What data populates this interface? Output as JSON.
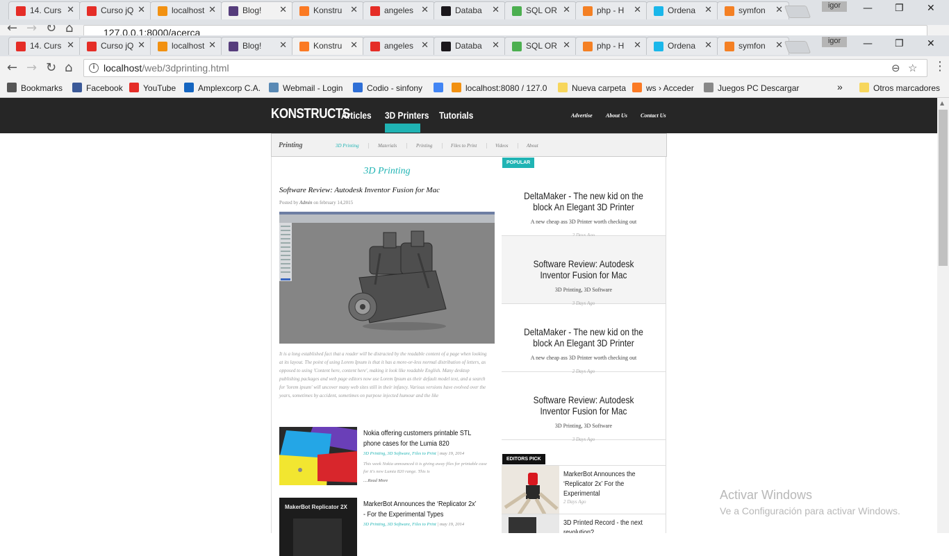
{
  "browser": {
    "tabs": [
      {
        "label": "14. Curs",
        "icon": "youtube-icon",
        "color": "#e52d27"
      },
      {
        "label": "Curso jQ",
        "icon": "youtube-icon",
        "color": "#e52d27"
      },
      {
        "label": "localhost",
        "icon": "phpmyadmin-icon",
        "color": "#f29111"
      },
      {
        "label": "Blog!",
        "icon": "bootstrap-icon",
        "color": "#563d7c"
      },
      {
        "label": "Konstru",
        "icon": "xampp-icon",
        "color": "#fb7a24"
      },
      {
        "label": "angeles",
        "icon": "youtube-icon",
        "color": "#e52d27"
      },
      {
        "label": "Databa",
        "icon": "symfony-icon",
        "color": "#1a171b"
      },
      {
        "label": "SQL OR",
        "icon": "w3schools-icon",
        "color": "#4caf50"
      },
      {
        "label": "php - H",
        "icon": "stackoverflow-icon",
        "color": "#f48024"
      },
      {
        "label": "Ordena",
        "icon": "vimeo-icon",
        "color": "#1ab7ea"
      },
      {
        "label": "symfon",
        "icon": "stackoverflow-icon",
        "color": "#f48024"
      }
    ],
    "back_active_tab": 3,
    "front_active_tab": 4,
    "profile": "igor",
    "back_url": "127.0.0.1:8000/acerca",
    "url_host": "localhost",
    "url_path": "/web/3dprinting.html",
    "bookmarks": [
      {
        "label": "Bookmarks",
        "icon": "star-icon",
        "color": "#555555"
      },
      {
        "label": "Facebook",
        "icon": "facebook-icon",
        "color": "#3b5998"
      },
      {
        "label": "YouTube",
        "icon": "youtube-icon",
        "color": "#e52d27"
      },
      {
        "label": "Amplexcorp C.A.",
        "icon": "amplexcorp-icon",
        "color": "#1565c0"
      },
      {
        "label": "Webmail - Login",
        "icon": "mail-icon",
        "color": "#5a8ab5"
      },
      {
        "label": "Codio - sinfony",
        "icon": "codio-icon",
        "color": "#2f6fd6"
      },
      {
        "label": "",
        "icon": "google-icon",
        "color": "#4285f4"
      },
      {
        "label": "localhost:8080 / 127.0",
        "icon": "phpmyadmin-icon",
        "color": "#f29111"
      },
      {
        "label": "Nueva carpeta",
        "icon": "folder-icon",
        "color": "#f7d65c"
      },
      {
        "label": "ws › Acceder",
        "icon": "xampp-icon",
        "color": "#fb7a24"
      },
      {
        "label": "Juegos PC Descargar",
        "icon": "page-icon",
        "color": "#888888"
      }
    ],
    "bookmarks_overflow": "»",
    "other_bookmarks": "Otros marcadores"
  },
  "site": {
    "logo": "KONSTRUCTS",
    "nav": [
      "Articles",
      "3D Printers",
      "Tutorials"
    ],
    "nav_active": 1,
    "top_links": [
      "Advertise",
      "About Us",
      "Contact Us"
    ],
    "accent": "#20b4b4",
    "subnav_title": "Printing",
    "subnav": [
      "3D Printing",
      "Materials",
      "Printing",
      "Files to Print",
      "Videos",
      "About"
    ],
    "subnav_active": 0
  },
  "main": {
    "page_title": "3D Printing",
    "post": {
      "title": "Software Review: Autodesk Inventor Fusion for Mac",
      "meta_prefix": "Posted by",
      "author": "Admin",
      "meta_on": "on",
      "date": "february 14,2015",
      "body": "It is a long established fact that a reader will be distracted by the readable content of a page when looking at its layout. The point of using Lorem Ipsum is that it has a more-or-less normal distribution of letters, as opposed to using 'Content here, content here', making it look like readable English. Many desktop publishing packages and web page editors now use Lorem Ipsum as their default model text, and a search for 'lorem ipsum' will uncover many web sites still in their infancy. Various versions have evolved over the years, sometimes by accident, sometimes on purpose injected humour and the like"
    },
    "cards": [
      {
        "title": "Nokia offering customers printable STL phone cases for the Lumia 820",
        "categories": "3D Printing, 3D Software, Files to Print",
        "date": "| may 19, 2014",
        "excerpt": "This week Nokia announced it is giving away files for printable case for it's new Lumia 820 range. This is",
        "more": "....Read More"
      },
      {
        "title": "MarkerBot Announces the ‘Replicator 2x’ - For the Experimental Types",
        "thumb_text": "MakerBot Replicator 2X",
        "categories": "3D Printing, 3D Software, Files to Print",
        "date": "| may 19, 2014"
      }
    ]
  },
  "sidebar": {
    "popular_label": "POPULAR",
    "popular": [
      {
        "title": "DeltaMaker - The new kid on the block An Elegant 3D Printer",
        "desc": "A new cheap ass 3D Printer worth checking out",
        "ago": "2 Days Ago"
      },
      {
        "title": "Software Review: Autodesk Inventor Fusion for Mac",
        "desc": "3D Printing, 3D Software",
        "ago": "3 Days Ago"
      },
      {
        "title": "DeltaMaker - The new kid on the block An Elegant 3D Printer",
        "desc": "A new cheap ass 3D Printer worth checking out",
        "ago": "2 Days Ago"
      },
      {
        "title": "Software Review: Autodesk Inventor Fusion for Mac",
        "desc": "3D Printing, 3D Software",
        "ago": "3 Days Ago"
      }
    ],
    "editors_label": "EDITORS PICK",
    "editors": [
      {
        "title": "MarkerBot Announces the ‘Replicator 2x’ For the Experimental",
        "ago": "2 Days Ago"
      },
      {
        "title": "3D Printed Record - the next revolution?",
        "ago": ""
      }
    ]
  },
  "os": {
    "watermark_title": "Activar Windows",
    "watermark_sub": "Ve a Configuración para activar Windows."
  }
}
